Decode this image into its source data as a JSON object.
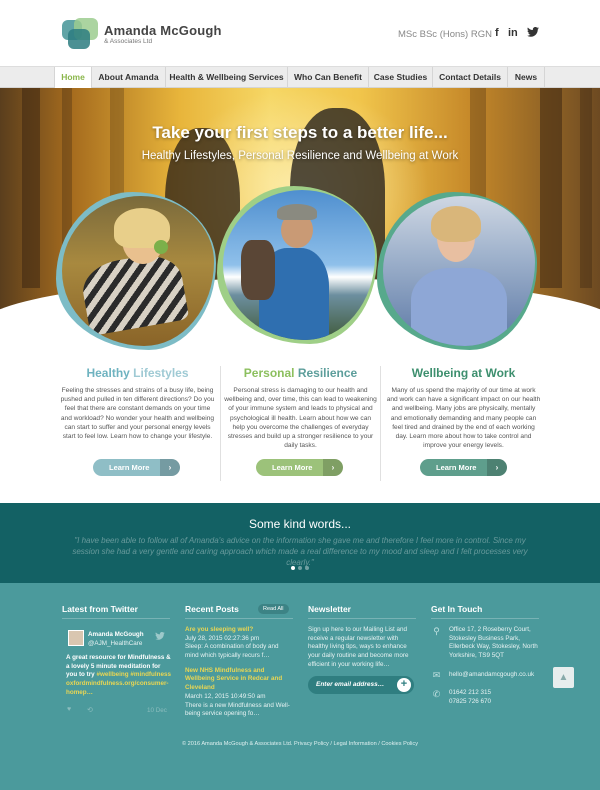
{
  "brand": {
    "name": "Amanda McGough",
    "sub": "& Associates Ltd"
  },
  "header": {
    "quals": "MSc  BSc (Hons)  RGN",
    "social": [
      "f",
      "in",
      "twitter-icon"
    ]
  },
  "nav": [
    {
      "label": "Home",
      "active": true
    },
    {
      "label": "About Amanda"
    },
    {
      "label": "Health & Wellbeing Services"
    },
    {
      "label": "Who Can Benefit"
    },
    {
      "label": "Case Studies"
    },
    {
      "label": "Contact Details"
    },
    {
      "label": "News"
    }
  ],
  "hero": {
    "title": "Take your first steps to a better life...",
    "subtitle": "Healthy Lifestyles, Personal Resilience and Wellbeing at Work"
  },
  "columns": [
    {
      "title_a": "Healthy",
      "title_b": " Lifestyles",
      "text": "Feeling the stresses and strains of a busy life, being pushed and pulled in ten different directions? Do you feel that there are constant demands on your time and workload? No wonder your health and wellbeing can start to suffer and your personal energy levels start to feel low. Learn how to change your lifestyle.",
      "button": "Learn More",
      "color_a": "#6fb3c0",
      "color_b": "#9fcad4",
      "button_color": "#8fbec6"
    },
    {
      "title_a": "Personal",
      "title_b": " Resilience",
      "text": "Personal stress is damaging to our health and wellbeing and, over time, this can lead to weakening of your immune system and leads to physical and psychological ill health. Learn about how we can help you overcome the challenges of everyday stresses and build up a stronger resilience to your daily tasks.",
      "button": "Learn More",
      "color_a": "#8cbf5e",
      "color_b": "#5d9e9b",
      "button_color": "#9cc27a"
    },
    {
      "title_a": "Wellbeing",
      "title_b": " at Work",
      "text": "Many of us spend the majority of our time at work and work can have a significant impact on our health and wellbeing. Many jobs are physically, mentally and emotionally demanding and many people can feel tired and drained by the end of each working day. Learn more about how to take control and improve your energy levels.",
      "button": "Learn More",
      "color_a": "#3d8f6e",
      "color_b": "#3d8f6e",
      "button_color": "#5e9e8c"
    }
  ],
  "kind_words": {
    "title": "Some kind words...",
    "quote": "\"I have been able to follow all of Amanda's advice on the information she gave me and therefore I feel more in control. Since my session she had a very gentle and caring approach which made a real difference to my mood and sleep and I felt processes very clearly.\""
  },
  "footer": {
    "twitter": {
      "heading": "Latest from Twitter",
      "user": "Amanda McGough",
      "handle": "@AJM_HealthCare",
      "tweet": "A great resource for Mindfulness & a lovely 5 minute meditation for you to try ",
      "tags": "#wellbeing #mindfulness",
      "url": "oxfordmindfulness.org/consumer-homep…",
      "date": "10 Dec"
    },
    "posts": {
      "heading": "Recent Posts",
      "read_all": "Read All",
      "items": [
        {
          "title": "Are you sleeping well?",
          "date": "July 28, 2015 02:27:36 pm",
          "excerpt": "Sleep: A combination of body and mind which typically recurs f…"
        },
        {
          "title": "New NHS Mindfulness and Wellbeing Service in Redcar and Cleveland",
          "date": "March 12, 2015 10:49:50 am",
          "excerpt": "There is a new Mindfulness and Well-being service opening fo…"
        }
      ]
    },
    "newsletter": {
      "heading": "Newsletter",
      "text": "Sign up here to our Mailing List and receive a regular newsletter with healthy living tips, ways to enhance your daily routine and become more efficient in your working life…",
      "placeholder": "Enter email address…",
      "go": "+"
    },
    "contact": {
      "heading": "Get In Touch",
      "address": "Office 17, 2 Roseberry Court, Stokesley Business Park, Ellerbeck Way, Stokesley, North Yorkshire, TS9 5QT",
      "email": "hello@amandamcgough.co.uk",
      "phone1": "01642 212 315",
      "phone2": "07825 726 670"
    },
    "copyright": "© 2016 Amanda McGough & Associates Ltd.  Privacy Policy  /  Legal Information  /  Cookies Policy"
  }
}
